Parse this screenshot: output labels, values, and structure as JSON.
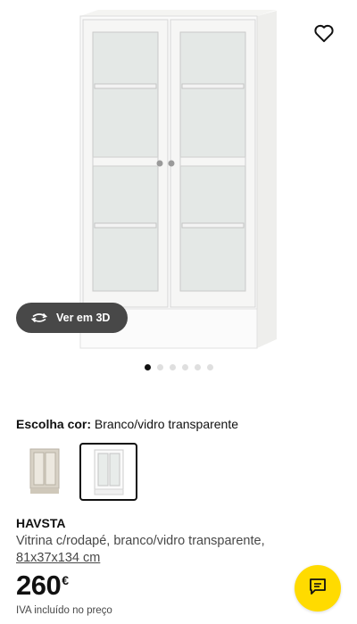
{
  "hero": {
    "view3d_label": "Ver em 3D",
    "favourite_icon": "heart-outline-icon",
    "view3d_icon": "rotate-360-icon"
  },
  "gallery": {
    "total_images": 6,
    "active_index": 0
  },
  "choice": {
    "label": "Escolha cor:",
    "value": "Branco/vidro transparente"
  },
  "swatches": [
    {
      "color": "beige",
      "selected": false
    },
    {
      "color": "white",
      "selected": true
    }
  ],
  "product": {
    "name": "HAVSTA",
    "description": "Vitrina c/rodapé, branco/vidro transparente,",
    "dimensions": "81x37x134 cm",
    "price": "260",
    "currency": "€",
    "vat_note": "IVA incluído no preço"
  },
  "chat": {
    "icon": "chat-bubble-icon",
    "color": "#ffdb00"
  }
}
